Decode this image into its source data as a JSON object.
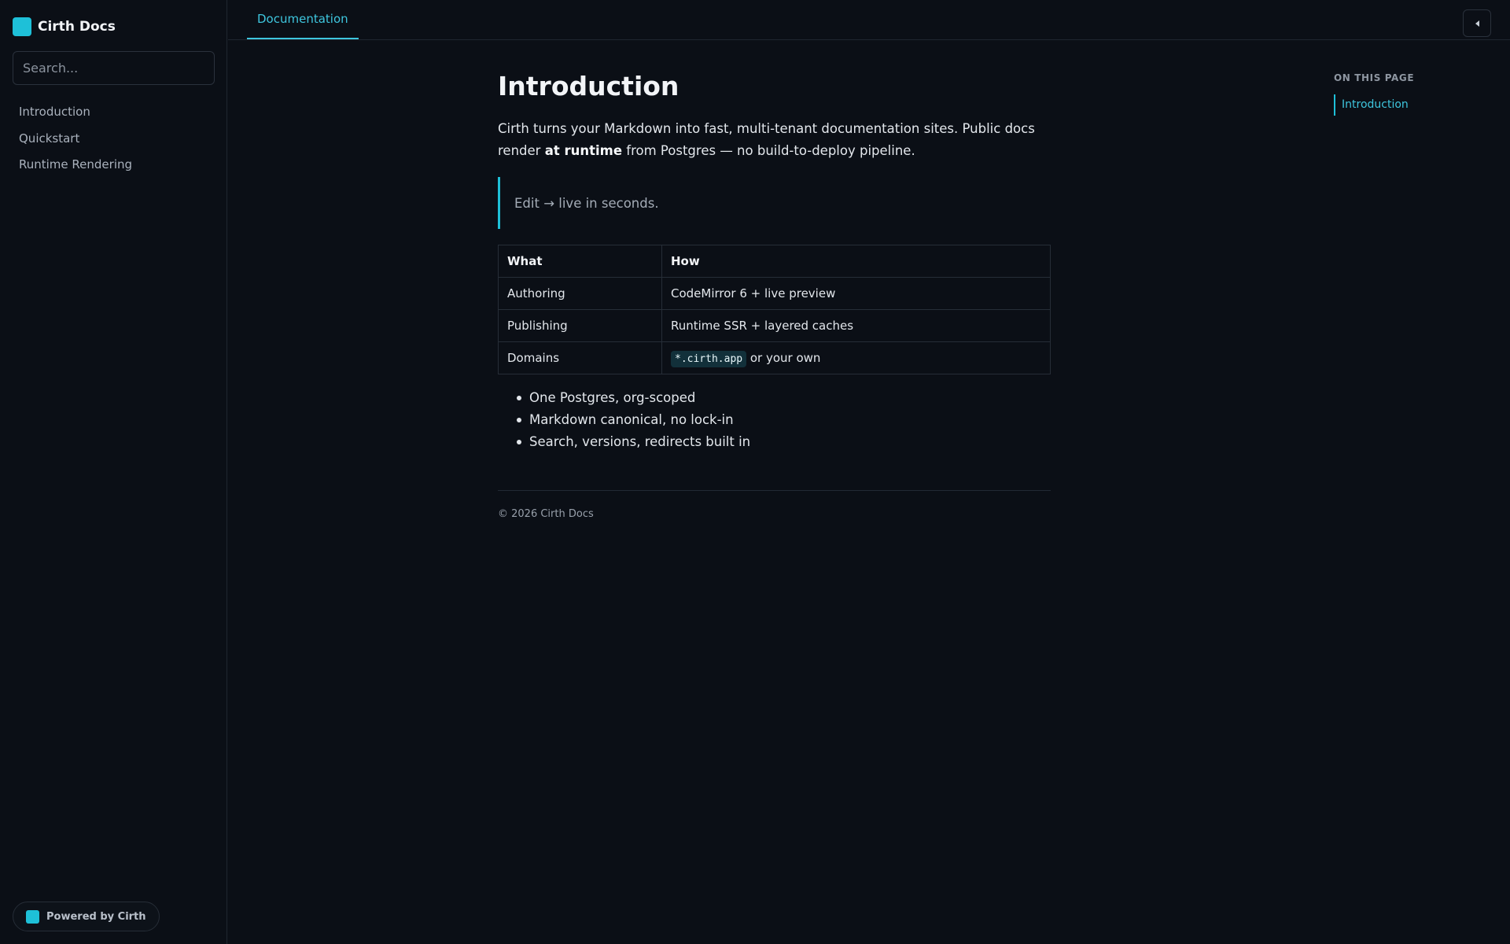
{
  "brand": {
    "title": "Cirth Docs"
  },
  "search": {
    "placeholder": "Search..."
  },
  "sidebar": {
    "items": [
      {
        "label": "Introduction"
      },
      {
        "label": "Quickstart"
      },
      {
        "label": "Runtime Rendering"
      }
    ],
    "powered_label": "Powered by Cirth"
  },
  "topbar": {
    "tabs": [
      {
        "label": "Documentation",
        "active": true
      }
    ]
  },
  "main": {
    "title": "Introduction",
    "intro_part1": "Cirth turns your Markdown into fast, multi-tenant documentation sites. Public docs render ",
    "intro_bold": "at runtime",
    "intro_part2": " from Postgres — no build-to-deploy pipeline.",
    "callout": "Edit → live in seconds.",
    "table": {
      "headers": [
        "What",
        "How"
      ],
      "rows": [
        [
          "Authoring",
          "CodeMirror 6 + live preview"
        ],
        [
          "Publishing",
          "Runtime SSR + layered caches"
        ],
        [
          "Domains",
          "*.cirth.app",
          " or your own"
        ]
      ]
    },
    "bullets": [
      "One Postgres, org-scoped",
      "Markdown canonical, no lock-in",
      "Search, versions, redirects built in"
    ],
    "footer": "© 2026 Cirth Docs"
  },
  "toc": {
    "heading": "ON THIS PAGE",
    "items": [
      {
        "label": "Introduction",
        "active": true
      }
    ]
  },
  "colors": {
    "background": "#0b0f16",
    "accent": "#1ec0d8",
    "accent_text": "#3ec6de",
    "border": "#1f2630"
  },
  "icons": {
    "brand_logo": "square-logo-icon",
    "collapse": "caret-left-icon"
  }
}
